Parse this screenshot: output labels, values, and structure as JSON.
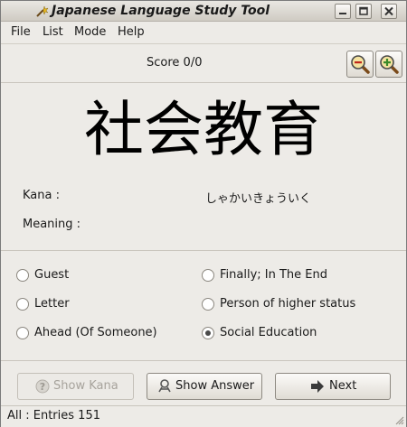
{
  "window": {
    "title": "Japanese Language Study Tool"
  },
  "menu": {
    "items": [
      "File",
      "List",
      "Mode",
      "Help"
    ]
  },
  "score": {
    "text": "Score 0/0"
  },
  "word": {
    "kanji": "社会教育",
    "kana_label": "Kana :",
    "kana_value": "しゃかいきょういく",
    "meaning_label": "Meaning :",
    "meaning_value": ""
  },
  "choices": [
    {
      "label": "Guest",
      "selected": false
    },
    {
      "label": "Finally; In The End",
      "selected": false
    },
    {
      "label": "Letter",
      "selected": false
    },
    {
      "label": "Person of higher status",
      "selected": false
    },
    {
      "label": "Ahead (Of Someone)",
      "selected": false
    },
    {
      "label": "Social Education",
      "selected": true
    }
  ],
  "buttons": {
    "show_kana": "Show Kana",
    "show_answer": "Show Answer",
    "next": "Next"
  },
  "status": {
    "text": "All : Entries 151"
  },
  "icons": [
    "app-icon",
    "minimize-icon",
    "maximize-icon",
    "close-icon",
    "zoom-out-icon",
    "zoom-in-icon",
    "help-icon",
    "search-icon",
    "arrow-right-icon"
  ]
}
